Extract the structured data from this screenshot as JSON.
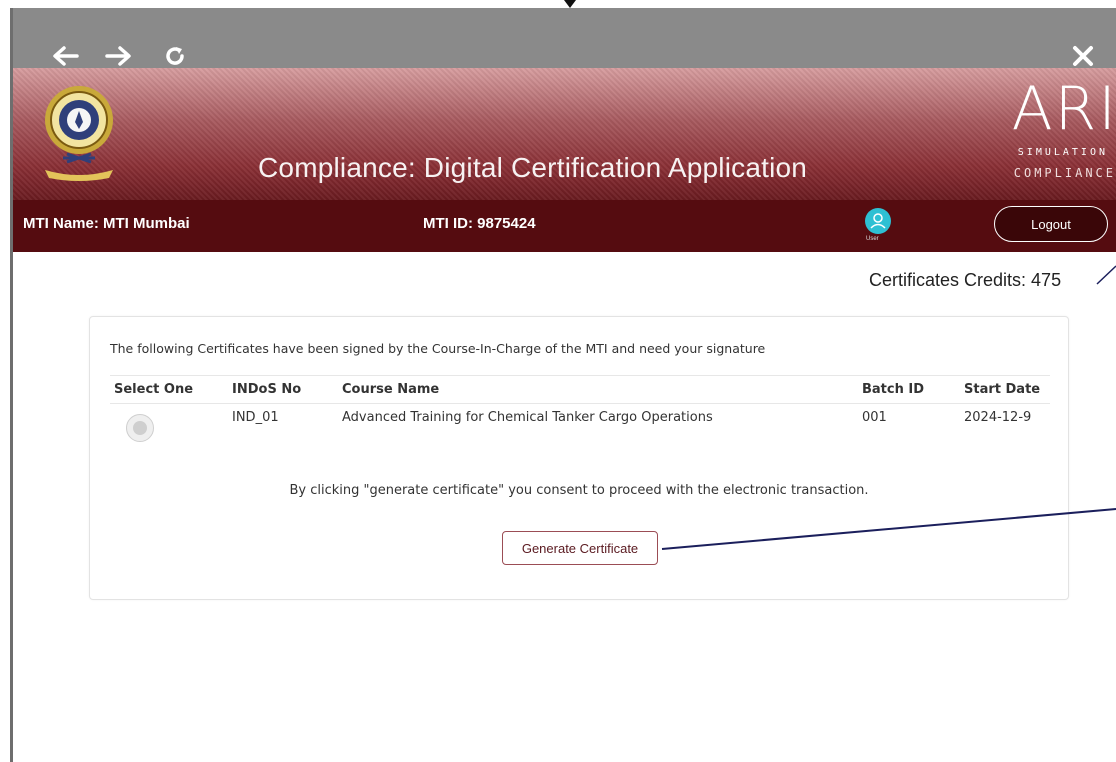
{
  "banner": {
    "title": "Compliance: Digital Certification Application"
  },
  "logo_right": {
    "letters": "ARI",
    "line1": "SIMULATION",
    "line2": "COMPLIANCE"
  },
  "info": {
    "mti_name": "MTI Name: MTI Mumbai",
    "mti_id": "MTI ID: 9875424",
    "user_label": "User",
    "logout": "Logout"
  },
  "credits": "Certificates Credits: 475",
  "card": {
    "intro": "The following Certificates have been signed by the Course-In-Charge of the MTI and need your signature",
    "headers": [
      "Select One",
      "INDoS No",
      "Course Name",
      "Batch ID",
      "Start Date"
    ],
    "rows": [
      {
        "indos": "IND_01",
        "course": "Advanced Training for Chemical Tanker Cargo Operations",
        "batch": "001",
        "start": "2024-12-9"
      }
    ],
    "consent": "By clicking \"generate certificate\" you consent to proceed with the electronic transaction.",
    "button": "Generate Certificate"
  },
  "colors": {
    "banner_dark": "#550c10",
    "accent_button": "#9b4d55",
    "user_avatar": "#2ec0d3"
  }
}
